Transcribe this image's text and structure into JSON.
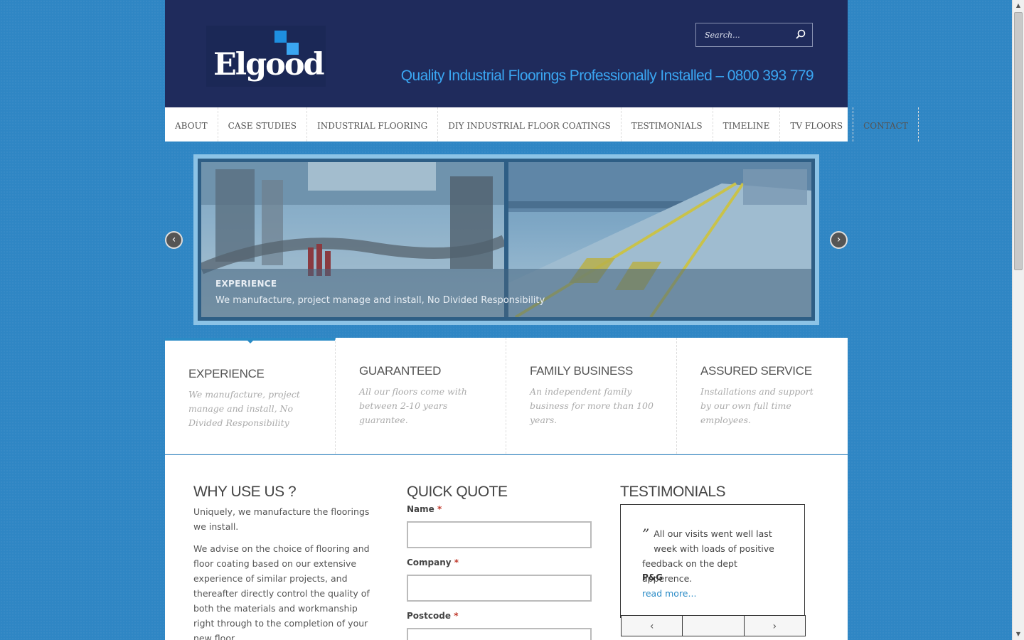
{
  "header": {
    "logo_text": "Elgood",
    "search_placeholder": "Search...",
    "tagline": "Quality Industrial Floorings Professionally Installed – 0800 393 779"
  },
  "nav": {
    "items": [
      {
        "label": "ABOUT"
      },
      {
        "label": "CASE STUDIES"
      },
      {
        "label": "INDUSTRIAL FLOORING"
      },
      {
        "label": "DIY INDUSTRIAL FLOOR COATINGS"
      },
      {
        "label": "TESTIMONIALS"
      },
      {
        "label": "TIMELINE"
      },
      {
        "label": "TV FLOORS"
      },
      {
        "label": "CONTACT"
      }
    ]
  },
  "slider": {
    "caption_title": "EXPERIENCE",
    "caption_text": "We manufacture, project manage and install, No Divided Responsibility",
    "prev_icon": "chevron-left-icon",
    "next_icon": "chevron-right-icon"
  },
  "features": [
    {
      "title": "EXPERIENCE",
      "text": "We manufacture, project manage and install, No Divided Responsibility",
      "active": true
    },
    {
      "title": "GUARANTEED",
      "text": "All our floors come with between 2-10 years guarantee."
    },
    {
      "title": "FAMILY BUSINESS",
      "text": "An independent family business for more than 100 years."
    },
    {
      "title": "ASSURED SERVICE",
      "text": "Installations and support by our own full time employees."
    }
  ],
  "why": {
    "title": "WHY USE US ?",
    "p1": "Uniquely, we manufacture the floorings we install.",
    "p2": "We advise on the choice of flooring and floor coating based on our extensive experience of similar projects, and thereafter directly control the quality of both the materials and workmanship right through to the completion of your new floor."
  },
  "quote": {
    "title": "QUICK QUOTE",
    "name_label": "Name",
    "company_label": "Company",
    "postcode_label": "Postcode",
    "required_mark": "*"
  },
  "testimonials": {
    "title": "TESTIMONIALS",
    "quote_mark": "”",
    "text": "All our visits went well last week with loads of positive feedback on the dept apperence.",
    "author": "P&G",
    "read_more": "read more..."
  },
  "colors": {
    "background": "#2f86c4",
    "header": "#1f2b5c",
    "accent": "#3aa6f2",
    "link": "#2a8bc6"
  }
}
